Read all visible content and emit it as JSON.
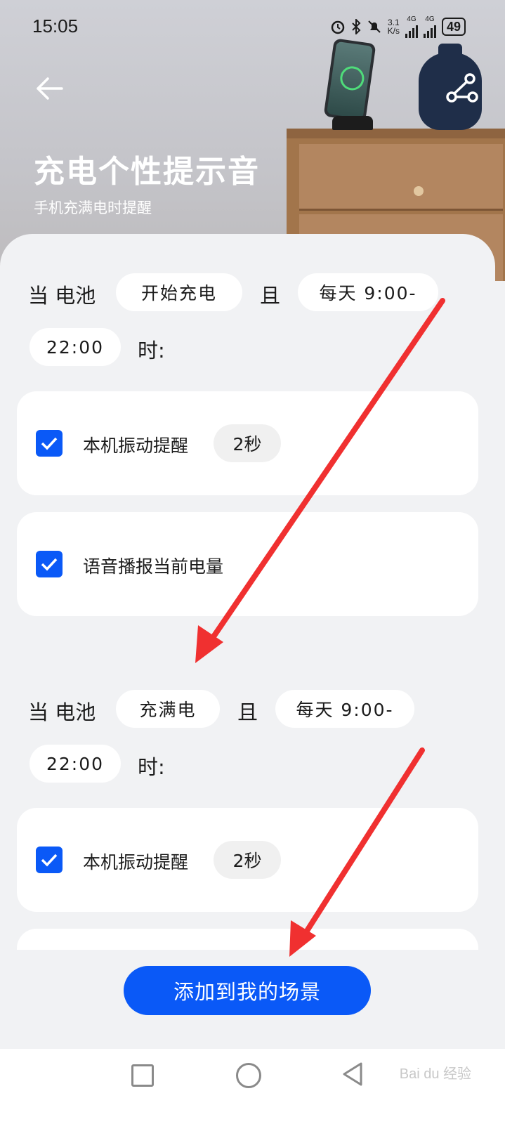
{
  "status_bar": {
    "time": "15:05",
    "net_speed_value": "3.1",
    "net_speed_unit": "K/s",
    "signal1_label": "4G",
    "signal2_label": "4G",
    "battery": "49"
  },
  "header": {
    "title": "充电个性提示音",
    "subtitle": "手机充满电时提醒"
  },
  "rules": [
    {
      "prefix": "当 电池",
      "event": "开始充电",
      "conjunction": "且",
      "time_part1": "每天 9:00-",
      "time_part2": "22:00",
      "suffix": "时:",
      "actions": [
        {
          "label": "本机振动提醒",
          "duration": "2秒",
          "checked": true
        },
        {
          "label": "语音播报当前电量",
          "checked": true
        }
      ]
    },
    {
      "prefix": "当 电池",
      "event": "充满电",
      "conjunction": "且",
      "time_part1": "每天 9:00-",
      "time_part2": "22:00",
      "suffix": "时:",
      "actions": [
        {
          "label": "本机振动提醒",
          "duration": "2秒",
          "checked": true
        }
      ]
    }
  ],
  "add_button_label": "添加到我的场景",
  "watermark": "Bai du 经验",
  "colors": {
    "accent": "#0a59f7",
    "arrow": "#f03030",
    "sheet_bg": "#f1f2f4"
  },
  "icons": [
    "back-arrow-icon",
    "share-icon",
    "alarm-icon",
    "bluetooth-icon",
    "mute-icon",
    "checkbox-checked-icon",
    "nav-recents-icon",
    "nav-home-icon",
    "nav-back-icon"
  ]
}
